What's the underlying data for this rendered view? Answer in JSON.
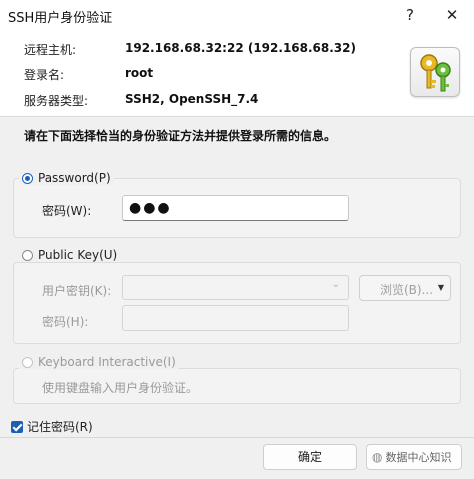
{
  "window": {
    "title": "SSH用户身份验证",
    "help": "?",
    "close": "✕"
  },
  "info": {
    "host_label": "远程主机:",
    "host_value": "192.168.68.32:22 (192.168.68.32)",
    "login_label": "登录名:",
    "login_value": "root",
    "server_label": "服务器类型:",
    "server_value": "SSH2, OpenSSH_7.4"
  },
  "instruction": "请在下面选择恰当的身份验证方法并提供登录所需的信息。",
  "password_group": {
    "label": "Password(P)",
    "selected": true,
    "field_label": "密码(W):",
    "field_value": "●●●"
  },
  "pubkey_group": {
    "label": "Public Key(U)",
    "user_key_label": "用户密钥(K):",
    "browse_label": "浏览(B)...",
    "passphrase_label": "密码(H):"
  },
  "keyboard_group": {
    "label": "Keyboard Interactive(I)",
    "desc": "使用键盘输入用户身份验证。"
  },
  "remember": {
    "label": "记住密码(R)",
    "checked": true
  },
  "buttons": {
    "ok": "确定"
  },
  "watermark": "数据中心知识",
  "colors": {
    "accent": "#1a5fb4",
    "header_bg": "#ffffff",
    "body_bg": "#f0f0f0"
  }
}
